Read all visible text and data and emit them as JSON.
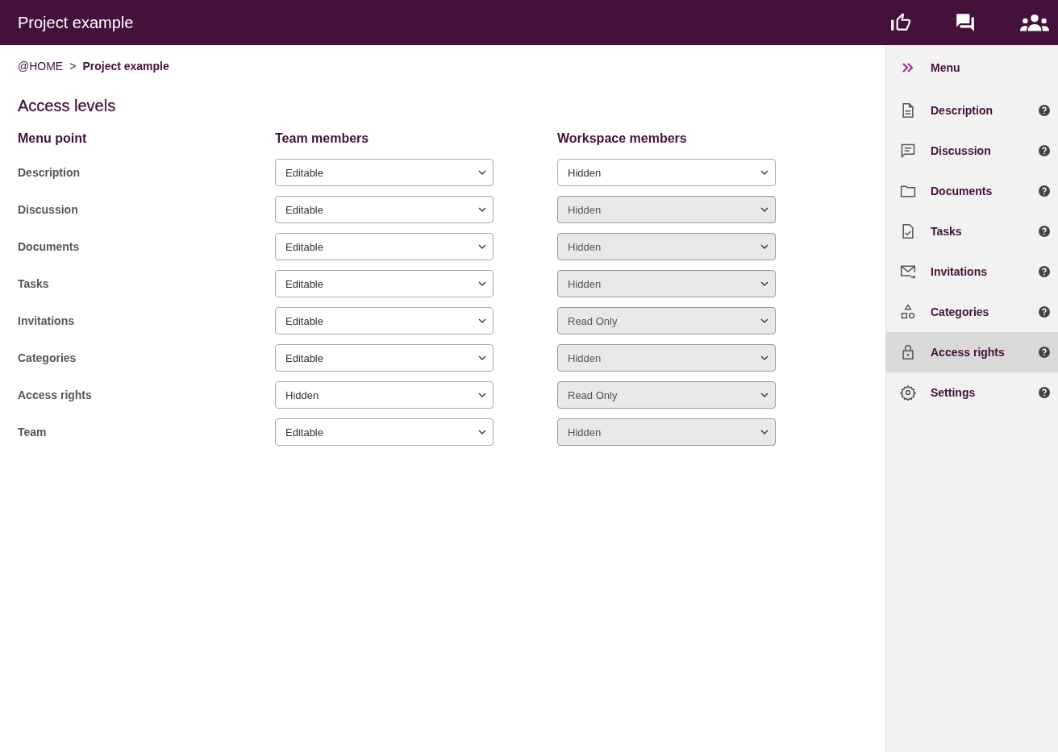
{
  "header": {
    "title": "Project example"
  },
  "breadcrumb": {
    "home": "@HOME",
    "separator": ">",
    "current": "Project example"
  },
  "page_title": "Access levels",
  "columns": [
    "Menu point",
    "Team members",
    "Workspace members"
  ],
  "rows": [
    {
      "label": "Description",
      "team": {
        "value": "Editable",
        "disabled": false
      },
      "workspace": {
        "value": "Hidden",
        "disabled": false
      }
    },
    {
      "label": "Discussion",
      "team": {
        "value": "Editable",
        "disabled": false
      },
      "workspace": {
        "value": "Hidden",
        "disabled": true
      }
    },
    {
      "label": "Documents",
      "team": {
        "value": "Editable",
        "disabled": false
      },
      "workspace": {
        "value": "Hidden",
        "disabled": true
      }
    },
    {
      "label": "Tasks",
      "team": {
        "value": "Editable",
        "disabled": false
      },
      "workspace": {
        "value": "Hidden",
        "disabled": true
      }
    },
    {
      "label": "Invitations",
      "team": {
        "value": "Editable",
        "disabled": false
      },
      "workspace": {
        "value": "Read Only",
        "disabled": true
      }
    },
    {
      "label": "Categories",
      "team": {
        "value": "Editable",
        "disabled": false
      },
      "workspace": {
        "value": "Hidden",
        "disabled": true
      }
    },
    {
      "label": "Access rights",
      "team": {
        "value": "Hidden",
        "disabled": false
      },
      "workspace": {
        "value": "Read Only",
        "disabled": true
      }
    },
    {
      "label": "Team",
      "team": {
        "value": "Editable",
        "disabled": false
      },
      "workspace": {
        "value": "Hidden",
        "disabled": true
      }
    }
  ],
  "sidebar": {
    "title": "Menu",
    "items": [
      {
        "label": "Description",
        "selected": false
      },
      {
        "label": "Discussion",
        "selected": false
      },
      {
        "label": "Documents",
        "selected": false
      },
      {
        "label": "Tasks",
        "selected": false
      },
      {
        "label": "Invitations",
        "selected": false
      },
      {
        "label": "Categories",
        "selected": false
      },
      {
        "label": "Access rights",
        "selected": true
      },
      {
        "label": "Settings",
        "selected": false
      }
    ]
  }
}
